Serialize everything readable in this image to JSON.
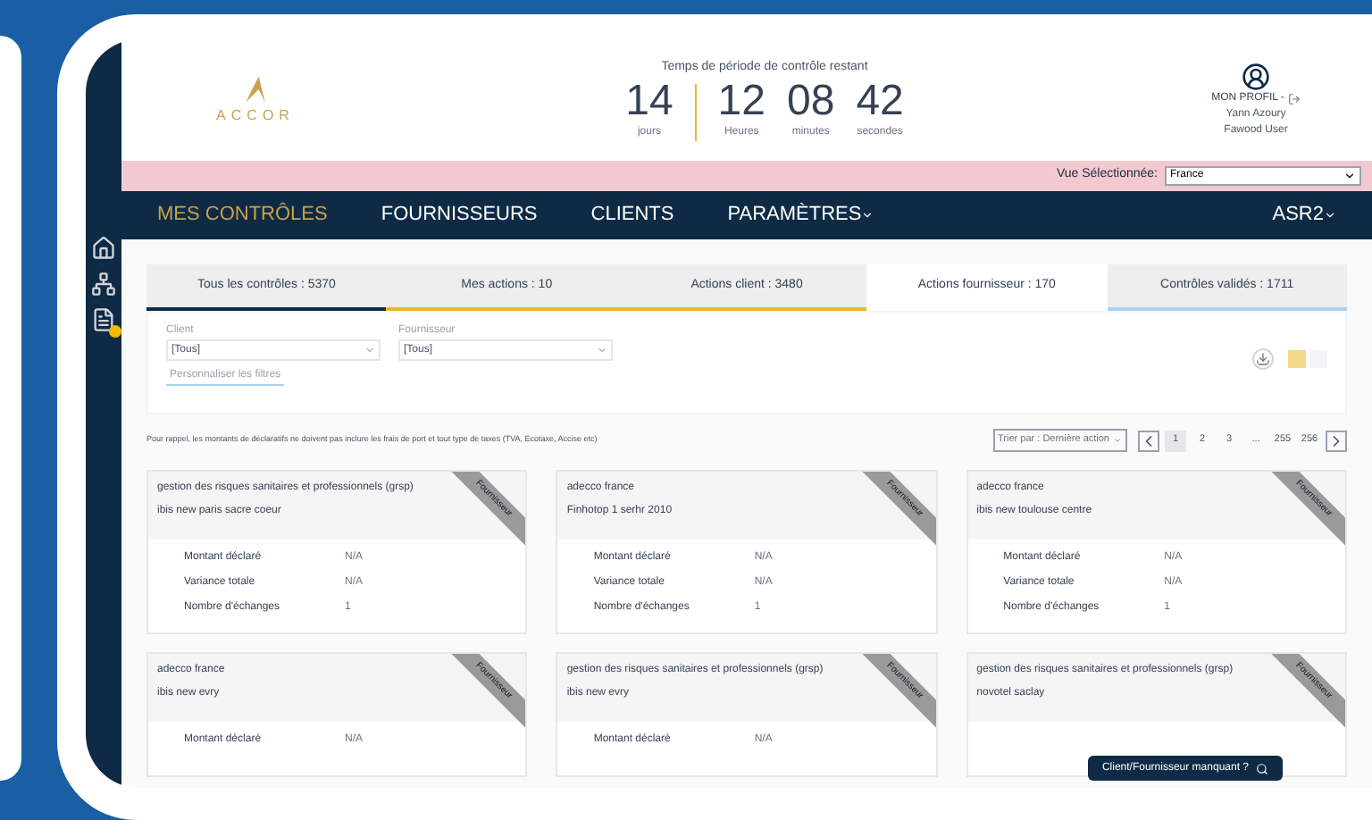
{
  "header": {
    "logo": "ACCOR",
    "timer_title": "Temps de période de contrôle restant",
    "timer": [
      {
        "value": "14",
        "unit": "jours"
      },
      {
        "value": "12",
        "unit": "Heures"
      },
      {
        "value": "08",
        "unit": "minutes"
      },
      {
        "value": "42",
        "unit": "secondes"
      }
    ],
    "profile": {
      "link": "MON PROFIL -",
      "name": "Yann Azoury",
      "role": "Fawood User"
    }
  },
  "view_bar": {
    "label": "Vue Sélectionnée:",
    "value": "France"
  },
  "nav": {
    "items": [
      {
        "label": "MES CONTRÔLES",
        "selected": true,
        "dropdown": false
      },
      {
        "label": "FOURNISSEURS",
        "selected": false,
        "dropdown": false
      },
      {
        "label": "CLIENTS",
        "selected": false,
        "dropdown": false
      },
      {
        "label": "PARAMÈTRES",
        "selected": false,
        "dropdown": true
      }
    ],
    "user": "ASR2"
  },
  "sidebar": {
    "items": [
      {
        "kind": "home",
        "badge": false
      },
      {
        "kind": "network",
        "badge": false
      },
      {
        "kind": "document",
        "badge": true
      }
    ]
  },
  "tabs": [
    {
      "label": "Tous les contrôles : 5370",
      "selected": false,
      "color": "#0f2a44"
    },
    {
      "label": "Mes actions : 10",
      "selected": false,
      "color": "#e8b830"
    },
    {
      "label": "Actions client : 3480",
      "selected": false,
      "color": "#e8b830"
    },
    {
      "label": "Actions fournisseur : 170",
      "selected": true,
      "color": "#ffffff"
    },
    {
      "label": "Contrôles validés : 1711",
      "selected": false,
      "color": "#a8d4ef"
    }
  ],
  "filters": [
    {
      "label": "Client",
      "value": "[Tous]"
    },
    {
      "label": "Fournisseur",
      "value": "[Tous]"
    }
  ],
  "customize_link": "Personnaliser les filtres",
  "view_toggle": [
    {
      "selected": true
    },
    {
      "selected": false
    }
  ],
  "note": "Pour rappel, les montants de déclaratifs ne doivent pas inclure les frais de port et tout type de taxes (TVA, Ecotaxe, Accise etc)",
  "sort": "Trier par : Dernière action",
  "pagination": [
    {
      "label": "1",
      "selected": true
    },
    {
      "label": "2",
      "selected": false
    },
    {
      "label": "3",
      "selected": false
    },
    {
      "label": "...",
      "selected": false
    },
    {
      "label": "255",
      "selected": false
    },
    {
      "label": "256",
      "selected": false
    }
  ],
  "cards": [
    {
      "ribbon": "Fournisseur",
      "company": "gestion des risques sanitaires et professionnels (grsp)",
      "site": "ibis new paris sacre coeur",
      "fields": [
        {
          "label": "Montant déclaré",
          "value": "N/A"
        },
        {
          "label": "Variance totale",
          "value": "N/A"
        },
        {
          "label": "Nombre d'échanges",
          "value": "1"
        }
      ]
    },
    {
      "ribbon": "Fournisseur",
      "company": "adecco france",
      "site": "Finhotop 1 serhr 2010",
      "fields": [
        {
          "label": "Montant déclaré",
          "value": "N/A"
        },
        {
          "label": "Variance totale",
          "value": "N/A"
        },
        {
          "label": "Nombre d'échanges",
          "value": "1"
        }
      ]
    },
    {
      "ribbon": "Fournisseur",
      "company": "adecco france",
      "site": "ibis new toulouse centre",
      "fields": [
        {
          "label": "Montant déclaré",
          "value": "N/A"
        },
        {
          "label": "Variance totale",
          "value": "N/A"
        },
        {
          "label": "Nombre d'échanges",
          "value": "1"
        }
      ]
    },
    {
      "ribbon": "Fournisseur",
      "company": "adecco france",
      "site": "ibis new evry",
      "fields": [
        {
          "label": "Montant déclaré",
          "value": "N/A"
        }
      ]
    },
    {
      "ribbon": "Fournisseur",
      "company": "gestion des risques sanitaires et professionnels (grsp)",
      "site": "ibis new evry",
      "fields": [
        {
          "label": "Montant déclaré",
          "value": "N/A"
        }
      ]
    },
    {
      "ribbon": "Fournisseur",
      "company": "gestion des risques sanitaires et professionnels (grsp)",
      "site": "novotel saclay"
    }
  ],
  "missing_button": "Client/Fournisseur manquant ?"
}
